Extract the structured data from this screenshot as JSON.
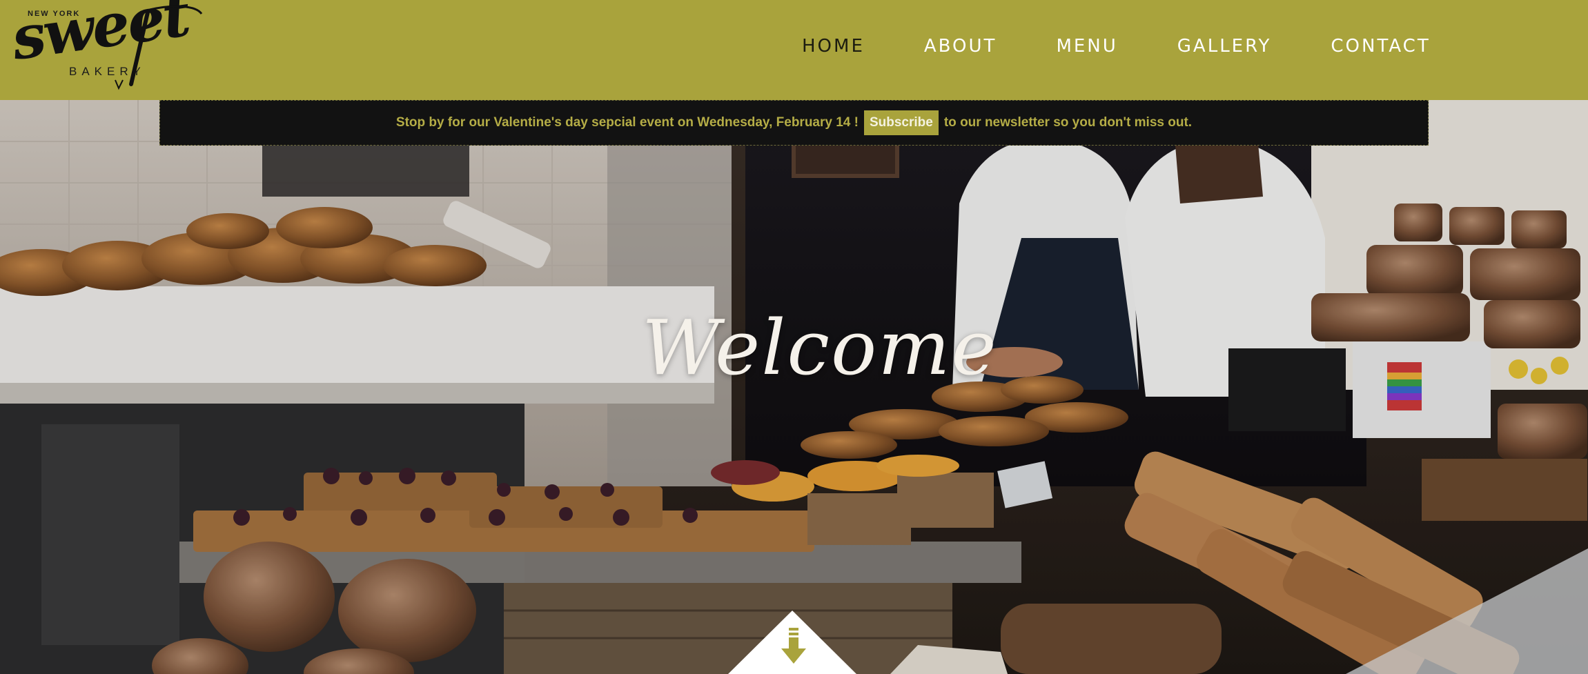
{
  "logo": {
    "top_text": "NEW YORK",
    "main_text": "sweet",
    "sub_text": "BAKERY"
  },
  "nav": {
    "items": [
      {
        "label": "HOME",
        "active": true
      },
      {
        "label": "ABOUT"
      },
      {
        "label": "MENU"
      },
      {
        "label": "GALLERY"
      },
      {
        "label": "CONTACT"
      }
    ]
  },
  "banner": {
    "text_before": "Stop by for our Valentine's day sepcial event on Wednesday, February 14 !",
    "button_label": "Subscribe",
    "text_after": "to our newsletter so you don't miss out."
  },
  "hero": {
    "welcome_text": "Welcome",
    "scroll_icon": "arrow-down-icon"
  },
  "colors": {
    "header_bg": "#a9a33c",
    "banner_bg": "#121212",
    "banner_text": "#b5ad46",
    "nav_text": "#ffffff",
    "nav_active": "#1c1c10"
  }
}
